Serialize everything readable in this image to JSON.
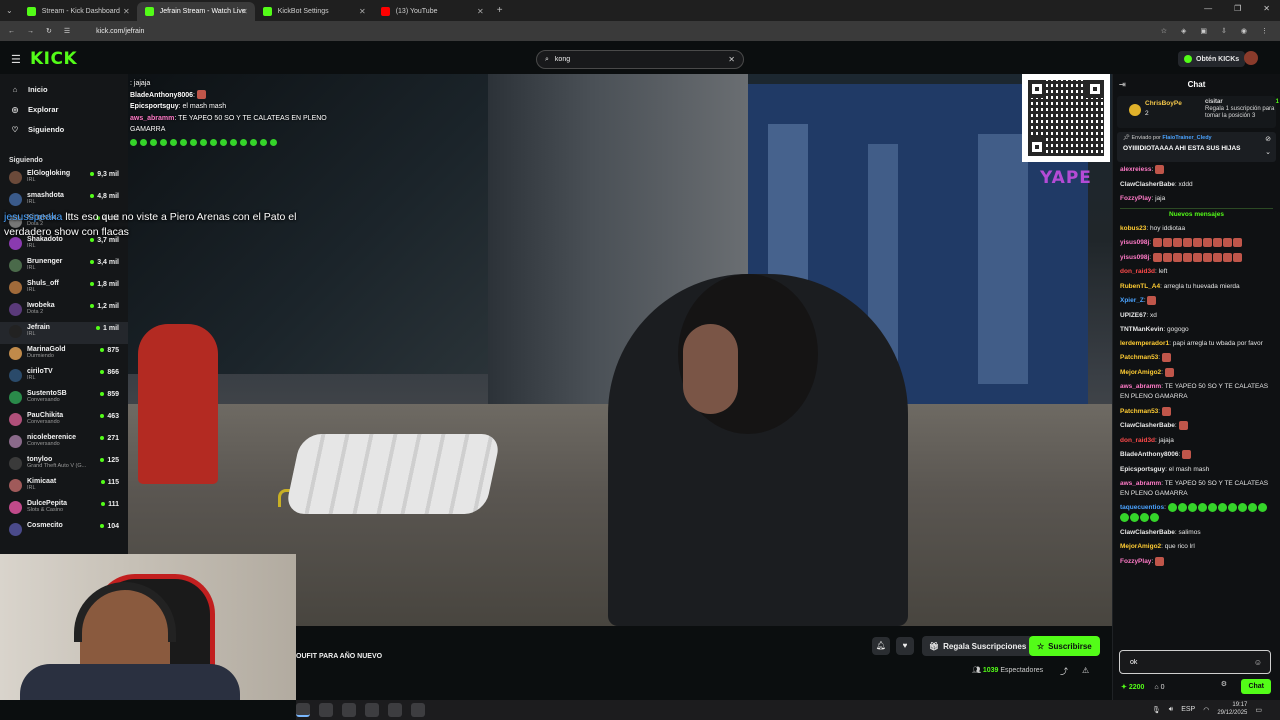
{
  "browser": {
    "tabs": [
      {
        "title": "Stream - Kick Dashboard",
        "active": false
      },
      {
        "title": "Jefrain Stream - Watch Live",
        "active": true
      },
      {
        "title": "KickBot Settings",
        "active": false
      },
      {
        "title": "(13) YouTube",
        "active": false
      }
    ],
    "url": "kick.com/jefrain"
  },
  "header": {
    "logo": "KICK",
    "search_value": "kong",
    "kicks_button": "Obtén KICKs"
  },
  "nav": [
    {
      "label": "Inicio",
      "icon": "home-icon"
    },
    {
      "label": "Explorar",
      "icon": "compass-icon"
    },
    {
      "label": "Siguiendo",
      "icon": "heart-icon"
    }
  ],
  "following": {
    "heading": "Siguiendo",
    "channels": [
      {
        "name": "ElGlogloking",
        "category": "IRL",
        "viewers": "9,3 mil",
        "color": "#6b4a3a"
      },
      {
        "name": "smashdota",
        "category": "IRL",
        "viewers": "4,8 mil",
        "color": "#3a5a8a"
      },
      {
        "name": "Kingteka",
        "category": "Dota 2",
        "viewers": "4 mil",
        "color": "#777777"
      },
      {
        "name": "Shakadoto",
        "category": "IRL",
        "viewers": "3,7 mil",
        "color": "#8a3ab0"
      },
      {
        "name": "Brunenger",
        "category": "IRL",
        "viewers": "3,4 mil",
        "color": "#4a6a4a"
      },
      {
        "name": "Shuls_off",
        "category": "IRL",
        "viewers": "1,8 mil",
        "color": "#a06a3a"
      },
      {
        "name": "Iwobeka",
        "category": "Dota 2",
        "viewers": "1,2 mil",
        "color": "#5a3a7a"
      },
      {
        "name": "Jefrain",
        "category": "IRL",
        "viewers": "1 mil",
        "color": "#222222"
      },
      {
        "name": "MarinaGold",
        "category": "Durmiendo",
        "viewers": "875",
        "color": "#c08a4a"
      },
      {
        "name": "ciriloTV",
        "category": "IRL",
        "viewers": "866",
        "color": "#2a4a6a"
      },
      {
        "name": "SustentoSB",
        "category": "Conversando",
        "viewers": "859",
        "color": "#2a8a4a"
      },
      {
        "name": "PauChikita",
        "category": "Conversando",
        "viewers": "463",
        "color": "#b0507a"
      },
      {
        "name": "nicoleberenice",
        "category": "Conversando",
        "viewers": "271",
        "color": "#8a6a8a"
      },
      {
        "name": "tonyloo",
        "category": "Grand Theft Auto V (G...",
        "viewers": "125",
        "color": "#3a3a3a"
      },
      {
        "name": "Kimicaat",
        "category": "IRL",
        "viewers": "115",
        "color": "#a05a5a"
      },
      {
        "name": "DulcePepita",
        "category": "Slots & Casino",
        "viewers": "111",
        "color": "#c04a8a"
      },
      {
        "name": "Cosmecito",
        "category": "",
        "viewers": "104",
        "color": "#4a4a8a"
      }
    ]
  },
  "video_overlay": {
    "chat": [
      {
        "user": "",
        "text": ": jajaja"
      },
      {
        "user": "BladeAnthony8006",
        "text": ":"
      },
      {
        "user": "Epicsportsguy",
        "text": ": el mash mash"
      },
      {
        "user": "aws_abramm",
        "text": ": TE YAPEO 50 SO Y TE CALATEAS EN PLENO GAMARRA"
      }
    ],
    "caption_user": "jesusspeaka",
    "caption_text": "ltts eso que no viste a Piero Arenas con el Pato el verdadero show con flacas",
    "yape_label": "YAPE"
  },
  "stream_info": {
    "title": "OUFIT PARA AÑO NUEVO",
    "gift_button": "Regala Suscripciones",
    "subscribe_button": "Suscribirse",
    "viewers_count": "1039",
    "viewers_label": "Espectadores"
  },
  "chat": {
    "header": "Chat",
    "pinned_user": "ChrisBoyPe",
    "pinned_count": "2",
    "pinned_right": "cisitar",
    "pinned_right_num": "1",
    "pinned_right_desc": "Regala 1 suscripción para tomar la posición 3",
    "sent_by_label": "Enviado por",
    "sent_by_user": "FlaioTrainer_Cledy",
    "sent_message": "OYIIIIDIOTAAAA AHI ESTA SUS HIJAS",
    "new_messages": "Nuevos mensajes",
    "messages_before": [
      {
        "user": "alexreiess",
        "text": "",
        "color": "#ff7ac7",
        "emotes": 1
      },
      {
        "user": "ClawClasherBabe",
        "text": "xddd",
        "color": "#e8e8e8",
        "emotes": 0
      },
      {
        "user": "FozzyPlay",
        "text": "jaja",
        "color": "#ff7ac7",
        "emotes": 0
      }
    ],
    "messages": [
      {
        "user": "kobus23",
        "text": "hoy iddiotaa",
        "color": "#ffcc33",
        "emotes": 0
      },
      {
        "user": "yisus098j",
        "text": "",
        "color": "#ff7ac7",
        "emotes": 9
      },
      {
        "user": "yisus098j",
        "text": "",
        "color": "#ff7ac7",
        "emotes": 9
      },
      {
        "user": "don_raid3d",
        "text": "left",
        "color": "#ff4a4a",
        "emotes": 0
      },
      {
        "user": "RubenTL_A4",
        "text": "arregla tu huevada mierda",
        "color": "#ffcc33",
        "emotes": 0
      },
      {
        "user": "Xpier_Z",
        "text": "",
        "color": "#4aa3ff",
        "emotes": 1
      },
      {
        "user": "UPIZE67",
        "text": "xd",
        "color": "#e8e8e8",
        "emotes": 0
      },
      {
        "user": "TNTManKevin",
        "text": "gogogo",
        "color": "#e8e8e8",
        "emotes": 0
      },
      {
        "user": "lerdemperador1",
        "text": "papi arregla tu wbada por favor",
        "color": "#ffcc33",
        "emotes": 0
      },
      {
        "user": "Patchman53",
        "text": "",
        "color": "#ffcc33",
        "emotes": 1
      },
      {
        "user": "MejorAmigo2",
        "text": "",
        "color": "#ffcc33",
        "emotes": 1
      },
      {
        "user": "aws_abramm",
        "text": "TE YAPEO 50 SO Y TE CALATEAS EN PLENO GAMARRA",
        "color": "#ff7ac7",
        "emotes": 0
      },
      {
        "user": "Patchman53",
        "text": "",
        "color": "#ffcc33",
        "emotes": 1
      },
      {
        "user": "ClawClasherBabe",
        "text": "",
        "color": "#e8e8e8",
        "emotes": 1
      },
      {
        "user": "don_raid3d",
        "text": "jajaja",
        "color": "#ff4a4a",
        "emotes": 0
      },
      {
        "user": "BladeAnthony8006",
        "text": "",
        "color": "#e8e8e8",
        "emotes": 1
      },
      {
        "user": "Epicsportsguy",
        "text": "el mash mash",
        "color": "#e8e8e8",
        "emotes": 0
      },
      {
        "user": "aws_abramm",
        "text": "TE YAPEO 50 SO Y TE CALATEAS EN PLENO GAMARRA",
        "color": "#ff7ac7",
        "emotes": 0
      },
      {
        "user": "taquecuentios",
        "text": "",
        "color": "#4aa3ff",
        "emotes": 14
      },
      {
        "user": "ClawClasherBabe",
        "text": "salimos",
        "color": "#e8e8e8",
        "emotes": 0
      },
      {
        "user": "MejorAmigo2",
        "text": "que rico lrl",
        "color": "#ffcc33",
        "emotes": 0
      },
      {
        "user": "FozzyPlay",
        "text": "",
        "color": "#ff7ac7",
        "emotes": 1
      }
    ],
    "input_value": "ok",
    "points": "2200",
    "redeem_count": "0",
    "send_button": "Chat"
  },
  "taskbar": {
    "time": "19:17",
    "date": "29/12/2025",
    "lang": "ESP"
  },
  "colors": {
    "accent": "#53fc18",
    "background": "#0b0e0f"
  }
}
